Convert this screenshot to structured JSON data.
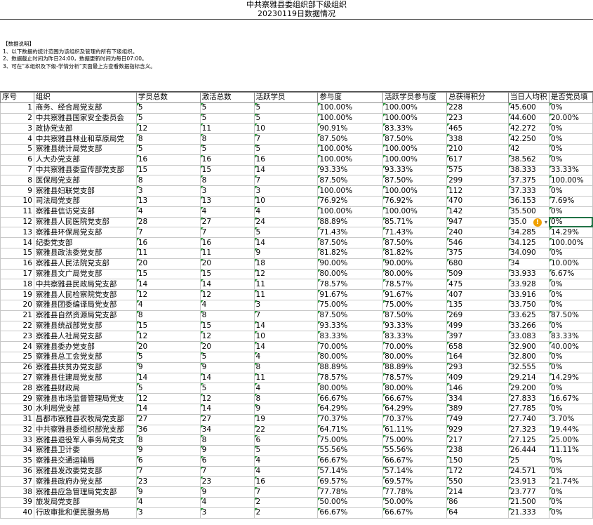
{
  "header": {
    "title": "中共察雅县委组织部下级组织",
    "subtitle": "20230119日数据情况"
  },
  "notes": {
    "heading": "【数据说明】",
    "lines": [
      "1、以下数据的统计范围为该组织及管理的所有下级组织。",
      "2、数据截止时间为昨日24:00，数据更新时间为每日07:00。",
      "3、可在“本组织及下级-学情分析”页面最上方查看数据指标含义。"
    ]
  },
  "columns": [
    "序号",
    "组织",
    "学员总数",
    "激活总数",
    "活跃学员",
    "参与度",
    "活跃学员参与度",
    "总获得积分",
    "当日人均积",
    "是否党员填"
  ],
  "rows": [
    [
      "1",
      "商务、经合局党支部",
      "5",
      "5",
      "5",
      "100.00%",
      "100.00%",
      "228",
      "45.600",
      "0%"
    ],
    [
      "2",
      "中共察雅县国家安全委员会",
      "5",
      "5",
      "5",
      "100.00%",
      "100.00%",
      "223",
      "44.600",
      "20.00%"
    ],
    [
      "3",
      "政协党支部",
      "12",
      "11",
      "10",
      "90.91%",
      "83.33%",
      "465",
      "42.272",
      "0%"
    ],
    [
      "4",
      "中共察雅县林业和草原局党",
      "8",
      "8",
      "7",
      "87.50%",
      "87.50%",
      "338",
      "42.250",
      "0%"
    ],
    [
      "5",
      "察雅县统计局党支部",
      "5",
      "5",
      "5",
      "100.00%",
      "100.00%",
      "210",
      "42",
      "0%"
    ],
    [
      "6",
      "人大办党支部",
      "16",
      "16",
      "16",
      "100.00%",
      "100.00%",
      "617",
      "38.562",
      "0%"
    ],
    [
      "7",
      "中共察雅县委宣传部党支部",
      "15",
      "15",
      "14",
      "93.33%",
      "93.33%",
      "575",
      "38.333",
      "33.33%"
    ],
    [
      "8",
      "医保局党支部",
      "8",
      "8",
      "7",
      "87.50%",
      "87.50%",
      "299",
      "37.375",
      "100.00%"
    ],
    [
      "9",
      "察雅县妇联党支部",
      "3",
      "3",
      "3",
      "100.00%",
      "100.00%",
      "112",
      "37.333",
      "0%"
    ],
    [
      "10",
      "司法局党支部",
      "13",
      "13",
      "10",
      "76.92%",
      "76.92%",
      "470",
      "36.153",
      "7.69%"
    ],
    [
      "11",
      "察雅县信访党支部",
      "4",
      "4",
      "4",
      "100.00%",
      "100.00%",
      "142",
      "35.500",
      "0%"
    ],
    [
      "12",
      "察雅县人民医院党支部",
      "28",
      "27",
      "24",
      "88.89%",
      "85.71%",
      "947",
      "35.0",
      "0%"
    ],
    [
      "13",
      "察雅县环保局党支部",
      "7",
      "7",
      "5",
      "71.43%",
      "71.43%",
      "240",
      "34.285",
      "14.29%"
    ],
    [
      "14",
      "纪委党支部",
      "16",
      "16",
      "14",
      "87.50%",
      "87.50%",
      "546",
      "34.125",
      "100.00%"
    ],
    [
      "15",
      "察雅县政法委党支部",
      "11",
      "11",
      "9",
      "81.82%",
      "81.82%",
      "375",
      "34.090",
      "0%"
    ],
    [
      "16",
      "察雅县人民法院党支部",
      "20",
      "20",
      "18",
      "90.00%",
      "90.00%",
      "680",
      "34",
      "10.00%"
    ],
    [
      "17",
      "察雅县文广局党支部",
      "15",
      "15",
      "12",
      "80.00%",
      "80.00%",
      "509",
      "33.933",
      "6.67%"
    ],
    [
      "18",
      "中共察雅县民政局党支部",
      "14",
      "14",
      "11",
      "78.57%",
      "78.57%",
      "475",
      "33.928",
      "0%"
    ],
    [
      "19",
      "察雅县人民检察院党支部",
      "12",
      "12",
      "11",
      "91.67%",
      "91.67%",
      "407",
      "33.916",
      "0%"
    ],
    [
      "20",
      "察雅县团委编译局党支部",
      "4",
      "4",
      "3",
      "75.00%",
      "75.00%",
      "135",
      "33.750",
      "0%"
    ],
    [
      "21",
      "察雅县自然资源局党支部",
      "8",
      "8",
      "7",
      "87.50%",
      "87.50%",
      "269",
      "33.625",
      "87.50%"
    ],
    [
      "22",
      "察雅县统战部党支部",
      "15",
      "15",
      "14",
      "93.33%",
      "93.33%",
      "499",
      "33.266",
      "0%"
    ],
    [
      "23",
      "察雅县人社局党支部",
      "12",
      "12",
      "10",
      "83.33%",
      "83.33%",
      "397",
      "33.083",
      "83.33%"
    ],
    [
      "24",
      "察雅县委办党支部",
      "20",
      "20",
      "14",
      "70.00%",
      "70.00%",
      "658",
      "32.900",
      "40.00%"
    ],
    [
      "25",
      "察雅县总工会党支部",
      "5",
      "5",
      "4",
      "80.00%",
      "80.00%",
      "164",
      "32.800",
      "0%"
    ],
    [
      "26",
      "察雅县扶贫办党支部",
      "9",
      "9",
      "8",
      "88.89%",
      "88.89%",
      "293",
      "32.555",
      "0%"
    ],
    [
      "27",
      "察雅县住建局党支部",
      "14",
      "14",
      "11",
      "78.57%",
      "78.57%",
      "409",
      "29.214",
      "14.29%"
    ],
    [
      "28",
      "察雅县财政局",
      "5",
      "5",
      "4",
      "80.00%",
      "80.00%",
      "146",
      "29.200",
      "0%"
    ],
    [
      "29",
      "察雅县市场监督管理局党支",
      "12",
      "12",
      "8",
      "66.67%",
      "66.67%",
      "334",
      "27.833",
      "16.67%"
    ],
    [
      "30",
      "水利局党支部",
      "14",
      "14",
      "9",
      "64.29%",
      "64.29%",
      "389",
      "27.785",
      "0%"
    ],
    [
      "31",
      "昌都市察雅县农牧局党支部",
      "27",
      "27",
      "19",
      "70.37%",
      "70.37%",
      "749",
      "27.740",
      "3.70%"
    ],
    [
      "32",
      "中共察雅县委组织部党支部",
      "36",
      "34",
      "22",
      "64.71%",
      "61.11%",
      "929",
      "27.323",
      "19.44%"
    ],
    [
      "33",
      "察雅县退役军人事务局党支",
      "8",
      "8",
      "6",
      "75.00%",
      "75.00%",
      "217",
      "27.125",
      "25.00%"
    ],
    [
      "34",
      "察雅县卫计委",
      "9",
      "9",
      "5",
      "55.56%",
      "55.56%",
      "238",
      "26.444",
      "11.11%"
    ],
    [
      "35",
      "察雅县交通运输局",
      "6",
      "6",
      "4",
      "66.67%",
      "66.67%",
      "150",
      "25",
      "0%"
    ],
    [
      "36",
      "察雅县发改委党支部",
      "7",
      "7",
      "4",
      "57.14%",
      "57.14%",
      "172",
      "24.571",
      "0%"
    ],
    [
      "37",
      "察雅县政府办党支部",
      "23",
      "23",
      "16",
      "69.57%",
      "69.57%",
      "550",
      "23.913",
      "21.74%"
    ],
    [
      "38",
      "察雅县应急管理局党支部",
      "9",
      "9",
      "7",
      "77.78%",
      "77.78%",
      "214",
      "23.777",
      "0%"
    ],
    [
      "39",
      "旅发局党支部",
      "4",
      "4",
      "2",
      "50.00%",
      "50.00%",
      "86",
      "21.500",
      "0%"
    ],
    [
      "40",
      "行政审批和便民服务局",
      "3",
      "3",
      "2",
      "66.67%",
      "66.67%",
      "64",
      "21.333",
      "0%"
    ]
  ],
  "selected_cell": {
    "row": 12,
    "col": 9
  },
  "warning_icon": "exclamation-warning-icon",
  "colors": {
    "flag": "#2a9a3a",
    "selection": "#217346",
    "warning": "#f0a000"
  }
}
